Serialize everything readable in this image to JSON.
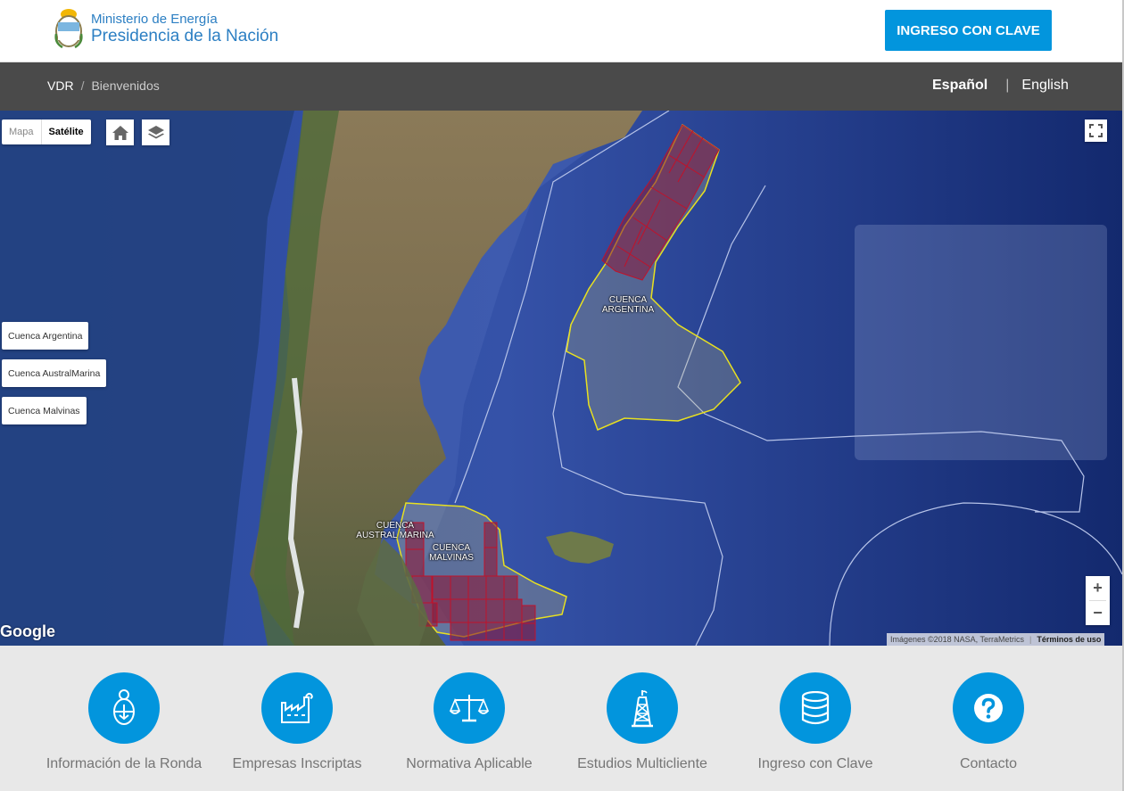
{
  "header": {
    "logo_line1": "Ministerio de Energía",
    "logo_line2": "Presidencia de la Nación",
    "login_button": "INGRESO CON CLAVE"
  },
  "breadcrumb": {
    "root": "VDR",
    "separator": "/",
    "current": "Bienvenidos"
  },
  "languages": {
    "active": "Español",
    "divider": "|",
    "other": "English"
  },
  "map": {
    "type_map": "Mapa",
    "type_satellite": "Satélite",
    "basin_buttons": [
      "Cuenca Argentina",
      "Cuenca AustralMarina",
      "Cuenca Malvinas"
    ],
    "labels": {
      "argentina": [
        "CUENCA",
        "ARGENTINA"
      ],
      "austral": [
        "CUENCA",
        "AUSTRAL MARINA"
      ],
      "malvinas": [
        "CUENCA",
        "MALVINAS"
      ]
    },
    "zoom_in": "+",
    "zoom_out": "−",
    "google_logo": "Google",
    "attribution": "Imágenes ©2018 NASA, TerraMetrics",
    "terms": "Términos de uso",
    "colors": {
      "ocean": "#1f3a8a",
      "basin_outline": "#e8e020",
      "block_fill": "#8a1a3a",
      "block_outline": "#c0122a"
    }
  },
  "shortcuts": [
    {
      "label": "Información de la Ronda",
      "icon": "coat-of-arms-icon"
    },
    {
      "label": "Empresas Inscriptas",
      "icon": "factory-icon"
    },
    {
      "label": "Normativa Aplicable",
      "icon": "scales-icon"
    },
    {
      "label": "Estudios Multicliente",
      "icon": "oil-rig-icon"
    },
    {
      "label": "Ingreso con Clave",
      "icon": "database-icon"
    },
    {
      "label": "Contacto",
      "icon": "question-icon"
    }
  ],
  "accent_color": "#0295dd"
}
